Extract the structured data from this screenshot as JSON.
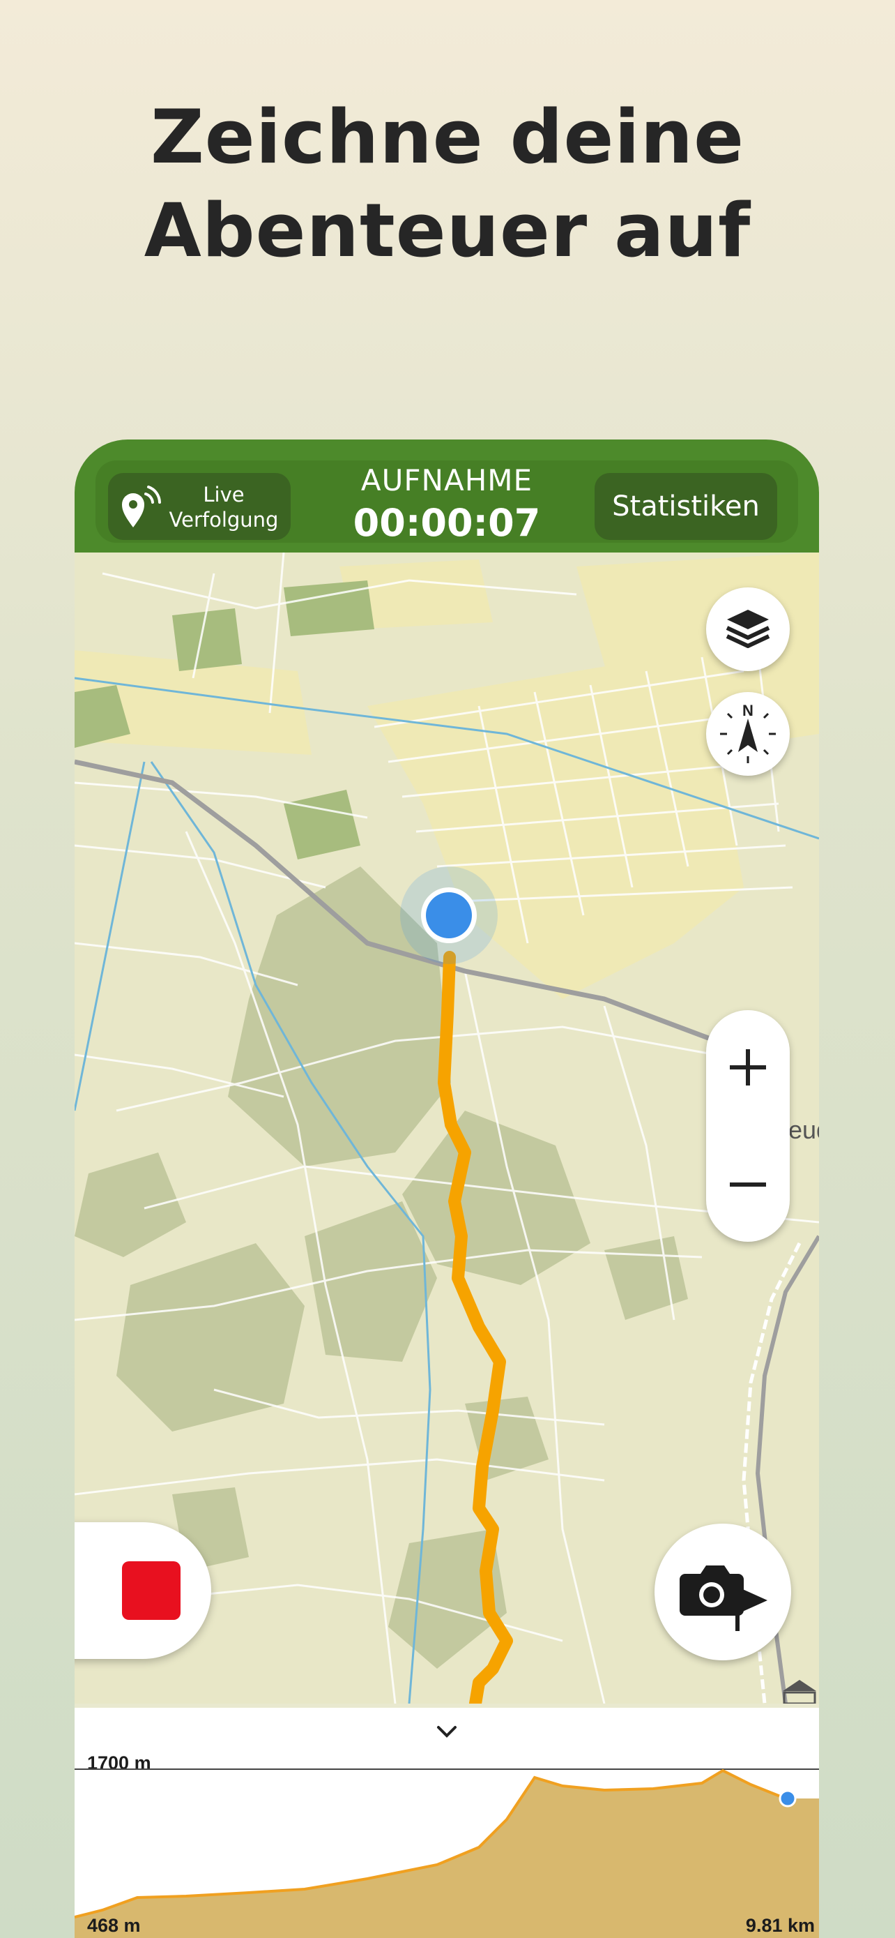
{
  "headline": {
    "line1": "Zeichne deine",
    "line2": "Abenteuer auf"
  },
  "topbar": {
    "live_line1": "Live",
    "live_line2": "Verfolgung",
    "recording_label": "AUFNAHME",
    "recording_time": "00:00:07",
    "stats_label": "Statistiken"
  },
  "map": {
    "compass_label": "N",
    "town_label_partial": "eud",
    "icons": [
      "layers-icon",
      "compass-icon",
      "zoom-in-icon",
      "zoom-out-icon",
      "stop-icon",
      "camera-waypoint-icon",
      "location-dot-icon"
    ],
    "track_color": "#f6a300",
    "location_color": "#3a8ee8"
  },
  "elevation": {
    "max_label": "1700 m",
    "min_label": "468 m",
    "distance_label": "9.81 km",
    "fill_color": "#d8b86e",
    "line_color": "#f0a020"
  },
  "colors": {
    "bar_green": "#4d8a2b",
    "button_dark": "#3b6422",
    "stop_red": "#e8101f"
  }
}
